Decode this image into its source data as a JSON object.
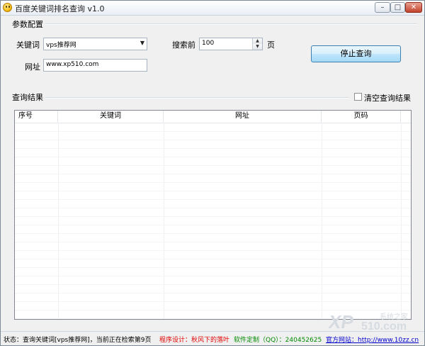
{
  "window": {
    "title": "百度关键词排名查询 v1.0",
    "controls": {
      "minimize": "–",
      "maximize": "□",
      "close": "✕"
    }
  },
  "params": {
    "group_label": "参数配置",
    "keyword_label": "关键词",
    "keyword_value": "vps推荐网",
    "url_label": "网址",
    "url_value": "www.xp510.com",
    "search_label": "搜索前",
    "search_value": "100",
    "page_suffix": "页",
    "stop_button": "停止查询"
  },
  "results": {
    "group_label": "查询结果",
    "clear_label": "清空查询结果",
    "clear_checked": false,
    "columns": [
      "序号",
      "关键词",
      "网址",
      "页码"
    ],
    "rows": []
  },
  "statusbar": {
    "status_text": "状态：查询关键词[vps推荐网]，当前正在检索第9页",
    "designer": "程序设计：秋风下的落叶",
    "custom": "软件定制（QQ）：240452625",
    "website": "官方网站：http://www.10zz.cn"
  },
  "watermark": {
    "brand": "XP",
    "sub": "510.com",
    "cn": "系统之家"
  },
  "colors": {
    "designer": "#e00000",
    "custom": "#008a00",
    "website": "#0000cc",
    "button_border": "#3c7fb1",
    "close_button": "#c2412a"
  }
}
